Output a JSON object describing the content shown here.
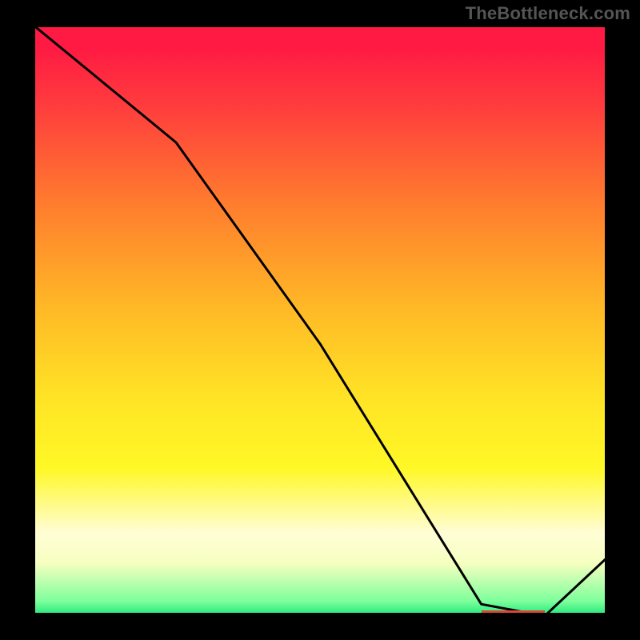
{
  "watermark": "TheBottleneck.com",
  "chart_data": {
    "type": "line",
    "x": [
      0.0,
      0.25,
      0.5,
      0.78,
      0.89,
      1.0
    ],
    "values": [
      1.0,
      0.8,
      0.46,
      0.02,
      0.0,
      0.1
    ],
    "xlabel": "",
    "ylabel": "",
    "xlim": [
      0,
      1
    ],
    "ylim": [
      0,
      1
    ],
    "background": "heat-gradient",
    "marker": {
      "x_start": 0.78,
      "x_end": 0.89,
      "y": 0.005,
      "color": "#d9463a"
    }
  },
  "colors": {
    "line": "#000000",
    "frame": "#000000",
    "watermark": "#555555"
  }
}
